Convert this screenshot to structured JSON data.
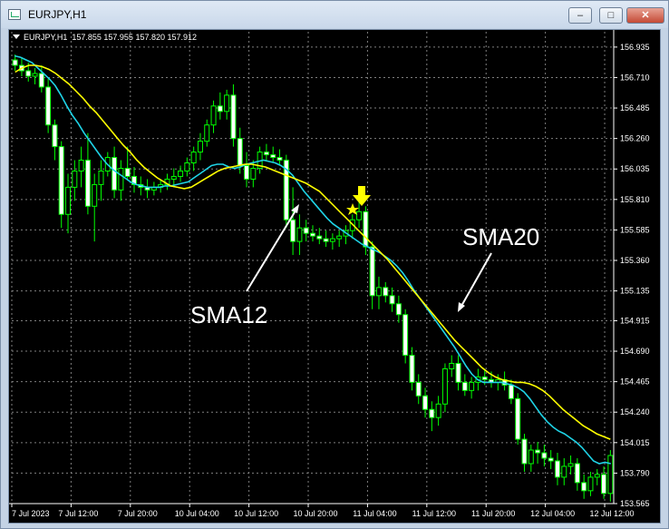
{
  "window": {
    "title": "EURJPY,H1",
    "min_icon": "minimize-icon",
    "max_icon": "maximize-icon",
    "close_icon": "close-icon"
  },
  "chart_header": {
    "symbol": "EURJPY,H1",
    "ohlc": "157.855 157.955 157.820 157.912"
  },
  "annotations": {
    "sma12_label": "SMA12",
    "sma20_label": "SMA20",
    "arrow_icon": "down-arrow-icon",
    "star_icon": "star-icon"
  },
  "colors": {
    "background": "#000000",
    "grid": "#7f7f7f",
    "bull": "#00ff00",
    "sma12": "#1fd3e6",
    "sma20": "#ffff00",
    "text": "#ffffff"
  },
  "chart_data": {
    "type": "line",
    "title": "",
    "ylim": [
      153.565,
      157.048
    ],
    "yticks": [
      "156.935",
      "156.710",
      "156.485",
      "156.260",
      "156.035",
      "155.810",
      "155.585",
      "155.360",
      "155.135",
      "154.915",
      "154.690",
      "154.465",
      "154.240",
      "154.015",
      "153.790",
      "153.565"
    ],
    "xticks": [
      "7 Jul 2023",
      "7 Jul 12:00",
      "7 Jul 20:00",
      "10 Jul 04:00",
      "10 Jul 12:00",
      "10 Jul 20:00",
      "11 Jul 04:00",
      "11 Jul 12:00",
      "11 Jul 20:00",
      "12 Jul 04:00",
      "12 Jul 12:00"
    ],
    "grid": true,
    "series": [
      {
        "name": "SMA12",
        "values": [
          156.87,
          156.86,
          156.84,
          156.82,
          156.78,
          156.74,
          156.7,
          156.65,
          156.58,
          156.5,
          156.43,
          156.37,
          156.3,
          156.24,
          156.18,
          156.12,
          156.07,
          156.03,
          156.0,
          155.97,
          155.94,
          155.92,
          155.91,
          155.9,
          155.9,
          155.9,
          155.91,
          155.91,
          155.92,
          155.93,
          155.94,
          155.97,
          156.0,
          156.03,
          156.06,
          156.07,
          156.07,
          156.05,
          156.04,
          156.05,
          156.07,
          156.08,
          156.09,
          156.1,
          156.09,
          156.08,
          156.06,
          156.03,
          155.99,
          155.93,
          155.87,
          155.82,
          155.77,
          155.72,
          155.67,
          155.63,
          155.6,
          155.57,
          155.54,
          155.51,
          155.48,
          155.46,
          155.44,
          155.42,
          155.39,
          155.36,
          155.32,
          155.27,
          155.21,
          155.14,
          155.08,
          155.02,
          154.96,
          154.9,
          154.84,
          154.78,
          154.72,
          154.65,
          154.58,
          154.52,
          154.48,
          154.46,
          154.46,
          154.46,
          154.46,
          154.45,
          154.44,
          154.42,
          154.39,
          154.34,
          154.28,
          154.22,
          154.17,
          154.13,
          154.1,
          154.08,
          154.05,
          154.02,
          153.98,
          153.93,
          153.88,
          153.86,
          153.87,
          153.86
        ]
      },
      {
        "name": "SMA20",
        "values": [
          156.75,
          156.78,
          156.8,
          156.8,
          156.79,
          156.77,
          156.74,
          156.7,
          156.66,
          156.61,
          156.56,
          156.5,
          156.45,
          156.39,
          156.33,
          156.27,
          156.21,
          156.16,
          156.1,
          156.05,
          156.01,
          155.97,
          155.94,
          155.91,
          155.9,
          155.89,
          155.9,
          155.93,
          155.96,
          155.99,
          156.02,
          156.04,
          156.05,
          156.06,
          156.07,
          156.07,
          156.06,
          156.05,
          156.03,
          156.01,
          155.99,
          155.97,
          155.95,
          155.93,
          155.9,
          155.87,
          155.82,
          155.77,
          155.72,
          155.67,
          155.62,
          155.57,
          155.52,
          155.47,
          155.42,
          155.37,
          155.31,
          155.25,
          155.19,
          155.13,
          155.07,
          155.01,
          154.95,
          154.89,
          154.83,
          154.77,
          154.72,
          154.67,
          154.62,
          154.57,
          154.53,
          154.5,
          154.48,
          154.47,
          154.46,
          154.46,
          154.45,
          154.43,
          154.4,
          154.36,
          154.31,
          154.26,
          154.22,
          154.18,
          154.14,
          154.11,
          154.08,
          154.06,
          154.04
        ]
      }
    ],
    "candles": [
      [
        156.84,
        156.88,
        156.76,
        156.8
      ],
      [
        156.8,
        156.86,
        156.72,
        156.76
      ],
      [
        156.76,
        156.82,
        156.68,
        156.72
      ],
      [
        156.72,
        156.78,
        156.66,
        156.74
      ],
      [
        156.74,
        156.8,
        156.6,
        156.64
      ],
      [
        156.64,
        156.7,
        156.3,
        156.36
      ],
      [
        156.36,
        156.4,
        156.1,
        156.2
      ],
      [
        156.2,
        156.24,
        155.6,
        155.7
      ],
      [
        155.7,
        156.0,
        155.56,
        155.9
      ],
      [
        155.9,
        156.1,
        155.8,
        156.02
      ],
      [
        156.02,
        156.2,
        155.9,
        156.1
      ],
      [
        156.1,
        156.3,
        155.7,
        155.76
      ],
      [
        155.76,
        156.0,
        155.5,
        155.92
      ],
      [
        155.92,
        156.1,
        155.8,
        156.02
      ],
      [
        156.02,
        156.16,
        155.98,
        156.12
      ],
      [
        156.12,
        156.2,
        155.82,
        155.88
      ],
      [
        155.88,
        156.1,
        155.8,
        156.04
      ],
      [
        156.04,
        156.2,
        155.95,
        155.98
      ],
      [
        155.98,
        156.05,
        155.86,
        155.92
      ],
      [
        155.92,
        155.98,
        155.84,
        155.9
      ],
      [
        155.9,
        155.96,
        155.82,
        155.88
      ],
      [
        155.88,
        155.94,
        155.84,
        155.9
      ],
      [
        155.9,
        155.96,
        155.86,
        155.92
      ],
      [
        155.92,
        156.0,
        155.88,
        155.96
      ],
      [
        155.96,
        156.04,
        155.9,
        155.98
      ],
      [
        155.98,
        156.06,
        155.94,
        156.02
      ],
      [
        156.02,
        156.12,
        155.98,
        156.08
      ],
      [
        156.08,
        156.2,
        156.02,
        156.16
      ],
      [
        156.16,
        156.3,
        156.1,
        156.24
      ],
      [
        156.24,
        156.4,
        156.2,
        156.36
      ],
      [
        156.36,
        156.54,
        156.3,
        156.5
      ],
      [
        156.5,
        156.6,
        156.4,
        156.46
      ],
      [
        156.46,
        156.62,
        156.4,
        156.58
      ],
      [
        156.58,
        156.66,
        156.2,
        156.26
      ],
      [
        156.26,
        156.34,
        156.0,
        156.06
      ],
      [
        156.06,
        156.16,
        155.9,
        155.96
      ],
      [
        155.96,
        156.1,
        155.9,
        156.04
      ],
      [
        156.04,
        156.2,
        156.0,
        156.16
      ],
      [
        156.16,
        156.22,
        156.1,
        156.14
      ],
      [
        156.14,
        156.2,
        156.08,
        156.12
      ],
      [
        156.12,
        156.18,
        156.06,
        156.1
      ],
      [
        156.1,
        156.14,
        155.6,
        155.66
      ],
      [
        155.66,
        155.9,
        155.4,
        155.5
      ],
      [
        155.5,
        155.7,
        155.4,
        155.6
      ],
      [
        155.6,
        155.66,
        155.5,
        155.56
      ],
      [
        155.56,
        155.62,
        155.5,
        155.54
      ],
      [
        155.54,
        155.6,
        155.48,
        155.52
      ],
      [
        155.52,
        155.58,
        155.46,
        155.5
      ],
      [
        155.5,
        155.56,
        155.44,
        155.52
      ],
      [
        155.52,
        155.58,
        155.46,
        155.54
      ],
      [
        155.54,
        155.62,
        155.48,
        155.58
      ],
      [
        155.58,
        155.7,
        155.52,
        155.66
      ],
      [
        155.66,
        155.86,
        155.6,
        155.72
      ],
      [
        155.72,
        155.76,
        155.4,
        155.46
      ],
      [
        155.46,
        155.5,
        155.0,
        155.1
      ],
      [
        155.1,
        155.24,
        155.0,
        155.16
      ],
      [
        155.16,
        155.2,
        155.05,
        155.1
      ],
      [
        155.1,
        155.16,
        154.98,
        155.04
      ],
      [
        155.04,
        155.1,
        154.9,
        154.96
      ],
      [
        154.96,
        155.0,
        154.6,
        154.66
      ],
      [
        154.66,
        154.72,
        154.4,
        154.46
      ],
      [
        154.46,
        154.52,
        154.3,
        154.36
      ],
      [
        154.36,
        154.42,
        154.2,
        154.26
      ],
      [
        154.26,
        154.32,
        154.1,
        154.2
      ],
      [
        154.2,
        154.36,
        154.14,
        154.3
      ],
      [
        154.3,
        154.6,
        154.24,
        154.56
      ],
      [
        154.56,
        154.66,
        154.5,
        154.6
      ],
      [
        154.6,
        154.66,
        154.4,
        154.46
      ],
      [
        154.46,
        154.52,
        154.36,
        154.4
      ],
      [
        154.4,
        154.5,
        154.34,
        154.46
      ],
      [
        154.46,
        154.56,
        154.4,
        154.5
      ],
      [
        154.5,
        154.56,
        154.44,
        154.48
      ],
      [
        154.48,
        154.54,
        154.42,
        154.46
      ],
      [
        154.46,
        154.52,
        154.4,
        154.48
      ],
      [
        154.48,
        154.54,
        154.4,
        154.44
      ],
      [
        154.44,
        154.48,
        154.3,
        154.34
      ],
      [
        154.34,
        154.38,
        154.0,
        154.04
      ],
      [
        154.04,
        154.08,
        153.8,
        153.86
      ],
      [
        153.86,
        154.0,
        153.8,
        153.96
      ],
      [
        153.96,
        154.02,
        153.86,
        153.94
      ],
      [
        153.94,
        154.0,
        153.84,
        153.9
      ],
      [
        153.9,
        153.96,
        153.82,
        153.88
      ],
      [
        153.88,
        153.94,
        153.7,
        153.76
      ],
      [
        153.76,
        153.9,
        153.7,
        153.84
      ],
      [
        153.84,
        153.92,
        153.78,
        153.86
      ],
      [
        153.86,
        153.9,
        153.66,
        153.72
      ],
      [
        153.72,
        153.78,
        153.6,
        153.66
      ],
      [
        153.66,
        153.8,
        153.62,
        153.76
      ],
      [
        153.76,
        153.82,
        153.7,
        153.78
      ],
      [
        153.78,
        153.84,
        153.6,
        153.64
      ],
      [
        153.64,
        153.96,
        153.58,
        153.92
      ]
    ]
  }
}
